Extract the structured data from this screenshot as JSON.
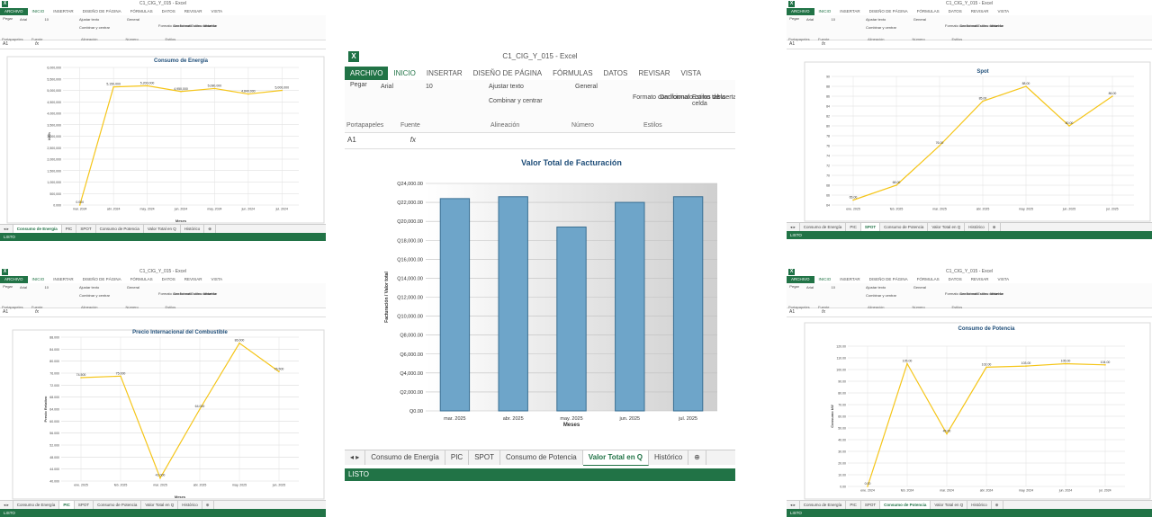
{
  "colors": {
    "excel_green": "#217346",
    "line_yellow": "#f5c518",
    "bar_blue": "#6ea5c9",
    "bar_border": "#3a6f93"
  },
  "ribbon": {
    "tabs": [
      "ARCHIVO",
      "INICIO",
      "INSERTAR",
      "DISEÑO DE PÁGINA",
      "FÓRMULAS",
      "DATOS",
      "REVISAR",
      "VISTA"
    ],
    "font_name": "Arial",
    "font_size": "10",
    "number_format": "General",
    "wrap_text": "Ajustar texto",
    "merge_center": "Combinar y centrar",
    "conditional_format": "Formato condicional",
    "format_table": "Dar formato como tabla",
    "cell_styles": "Estilos de celda",
    "insert": "Insertar",
    "groups": [
      "Portapapeles",
      "Fuente",
      "Alineación",
      "Número",
      "Estilos"
    ],
    "paste": "Pegar",
    "name_box": "A1",
    "fx": "fx"
  },
  "sheet_tabs": [
    "Consumo de Energía",
    "PIC",
    "SPOT",
    "Consumo de Potencia",
    "Valor Total en Q",
    "Histórico"
  ],
  "status": "LISTO",
  "windows": {
    "energia": {
      "title": "C1_CIG_Y_015 - Excel",
      "active_tab": "Consumo de Energía",
      "chart_data": {
        "type": "line",
        "title": "Consumo de Energía",
        "xlabel": "Meses",
        "ylabel": "kWh",
        "categories": [
          "mar. 2024",
          "abr. 2024",
          "may. 2024",
          "jun. 2024",
          "may. 2024",
          "jun. 2024",
          "jul. 2024"
        ],
        "values": [
          0,
          5150000,
          5200000,
          4950000,
          5080000,
          4840000,
          5000000
        ],
        "labels": [
          "0.000",
          "5,150,000",
          "5,200,000",
          "4,950,000",
          "5,080,000",
          "4,840,000",
          "5,000,000"
        ],
        "ylim": [
          0,
          6000000
        ],
        "yticks": [
          "0.000",
          "500,000",
          "1,000,000",
          "1,500,000",
          "2,000,000",
          "2,500,000",
          "3,000,000",
          "3,500,000",
          "4,000,000",
          "4,500,000",
          "5,000,000",
          "5,500,000",
          "6,000,000"
        ]
      }
    },
    "pic": {
      "title": "C1_CIG_Y_015 - Excel",
      "active_tab": "PIC",
      "chart_data": {
        "type": "line",
        "title": "Precio Internacional del Combustible",
        "xlabel": "Meses",
        "ylabel": "Precio Relativo",
        "categories": [
          "ene. 2025",
          "feb. 2025",
          "mar. 2025",
          "abr. 2025",
          "may. 2025",
          "jun. 2025"
        ],
        "values": [
          74.5,
          75.0,
          41.0,
          64.0,
          86.0,
          76.5
        ],
        "labels": [
          "74.500",
          "75.000",
          "41.000",
          "64.000",
          "86.000",
          "76.500"
        ],
        "ylim": [
          40,
          88
        ],
        "yticks": [
          "40.000",
          "44.000",
          "48.000",
          "52.000",
          "56.000",
          "60.000",
          "64.000",
          "68.000",
          "72.000",
          "76.000",
          "80.000",
          "84.000",
          "88.000"
        ]
      }
    },
    "main": {
      "title": "C1_CIG_Y_015 - Excel",
      "active_tab": "Valor Total en Q",
      "chart_data": {
        "type": "bar",
        "title": "Valor Total de Facturación",
        "xlabel": "Meses",
        "ylabel": "Facturación / Valor total",
        "categories": [
          "mar. 2025",
          "abr. 2025",
          "may. 2025",
          "jun. 2025",
          "jul. 2025"
        ],
        "values": [
          22400,
          22600,
          19400,
          22000,
          22600
        ],
        "ylim": [
          0,
          24000
        ],
        "yticks": [
          "Q0.00",
          "Q2,000.00",
          "Q4,000.00",
          "Q6,000.00",
          "Q8,000.00",
          "Q10,000.00",
          "Q12,000.00",
          "Q14,000.00",
          "Q16,000.00",
          "Q18,000.00",
          "Q20,000.00",
          "Q22,000.00",
          "Q24,000.00"
        ]
      }
    },
    "spot": {
      "title": "C1_CIG_Y_015 - Excel",
      "active_tab": "SPOT",
      "chart_data": {
        "type": "line",
        "title": "Spot",
        "xlabel": "",
        "ylabel": "",
        "categories": [
          "ene. 2025",
          "feb. 2025",
          "mar. 2025",
          "abr. 2025",
          "may. 2025",
          "jun. 2025",
          "jul. 2025"
        ],
        "values": [
          65.0,
          68.0,
          76.0,
          85.0,
          88.0,
          80.0,
          86.0
        ],
        "labels": [
          "65.00",
          "68.00",
          "76.00",
          "85.00",
          "88.00",
          "80.00",
          "86.00"
        ],
        "ylim": [
          64,
          90
        ],
        "yticks": [
          "64",
          "66",
          "68",
          "70",
          "72",
          "74",
          "76",
          "78",
          "80",
          "82",
          "84",
          "86",
          "88",
          "90"
        ]
      }
    },
    "potencia": {
      "title": "C1_CIG_Y_015 - Excel",
      "active_tab": "Consumo de Potencia",
      "chart_data": {
        "type": "line",
        "title": "Consumo de Potencia",
        "xlabel": "",
        "ylabel": "Consumo kW",
        "categories": [
          "ene. 2024",
          "feb. 2024",
          "mar. 2024",
          "abr. 2024",
          "may. 2024",
          "jun. 2024",
          "jul. 2024"
        ],
        "values": [
          0,
          105,
          45,
          102,
          103,
          105,
          104
        ],
        "labels": [
          "0.00",
          "105.00",
          "45.00",
          "102.00",
          "103.00",
          "105.00",
          "104.00"
        ],
        "ylim": [
          0,
          120
        ],
        "yticks": [
          "0.00",
          "10.00",
          "20.00",
          "30.00",
          "40.00",
          "50.00",
          "60.00",
          "70.00",
          "80.00",
          "90.00",
          "100.00",
          "110.00",
          "120.00"
        ]
      }
    }
  }
}
